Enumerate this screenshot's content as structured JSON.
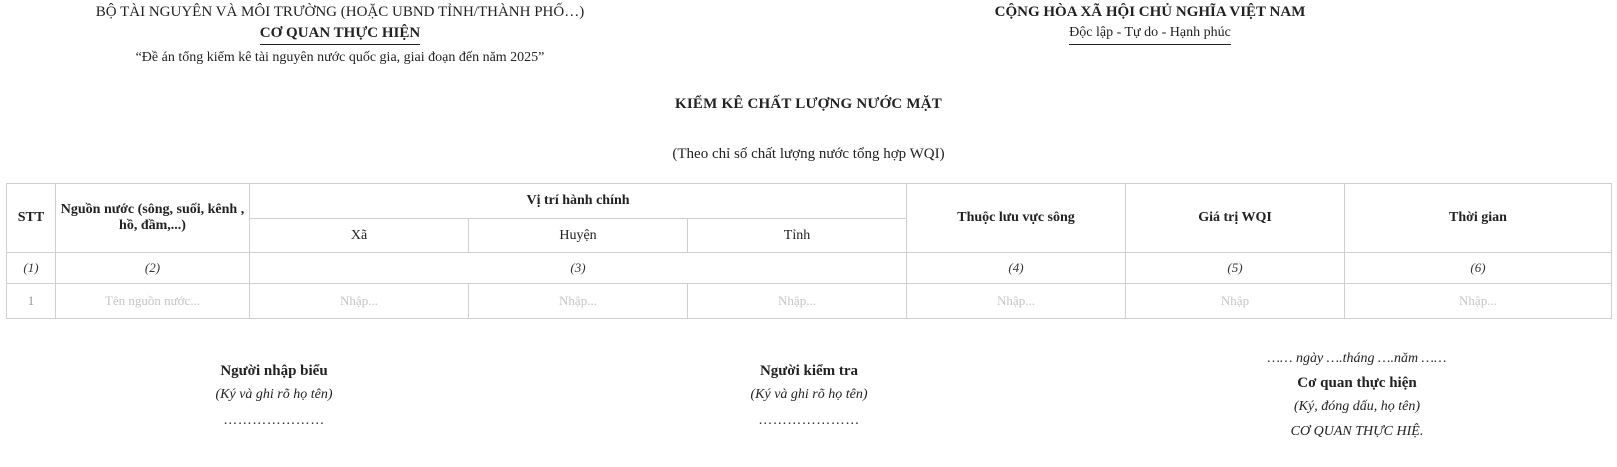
{
  "header": {
    "ministry": "BỘ TÀI NGUYÊN VÀ MÔI TRƯỜNG (HOẶC UBND TỈNH/THÀNH PHỐ…)",
    "agency": "CƠ QUAN THỰC HIỆN",
    "project": "“Đề án tổng kiểm kê tài nguyên nước quốc gia, giai đoạn đến năm 2025”",
    "nation": "CỘNG HÒA XÃ HỘI CHỦ NGHĨA VIỆT NAM",
    "motto": "Độc lập - Tự do - Hạnh phúc"
  },
  "title": "KIỂM KÊ CHẤT LƯỢNG NƯỚC MẶT",
  "subtitle": "(Theo chỉ số chất lượng nước tổng hợp WQI)",
  "table": {
    "headers": {
      "stt": "STT",
      "source": "Nguồn nước (sông, suối, kênh , hồ, đầm,...)",
      "admin_location": "Vị trí hành chính",
      "commune": "Xã",
      "district": "Huyện",
      "province": "Tỉnh",
      "basin": "Thuộc lưu vực sông",
      "wqi": "Giá trị WQI",
      "time": "Thời gian"
    },
    "column_numbers": [
      "(1)",
      "(2)",
      "(3)",
      "(4)",
      "(5)",
      "(6)"
    ],
    "rows": [
      {
        "stt": "1",
        "source": "Tên nguồn nước...",
        "commune": "Nhập...",
        "district": "Nhập...",
        "province": "Nhập...",
        "basin": "Nhập...",
        "wqi": "Nhập",
        "time": "Nhập..."
      }
    ]
  },
  "signatures": {
    "preparer": {
      "role": "Người nhập biểu",
      "hint": "(Ký và ghi rõ họ tên)",
      "dots": "…………………"
    },
    "checker": {
      "role": "Người kiểm tra",
      "hint": "(Ký và ghi rõ họ tên)",
      "dots": "…………………"
    },
    "agency": {
      "date": "…… ngày ….tháng ….năm ……",
      "role": "Cơ quan thực hiện",
      "hint": "(Ký, đóng dấu, họ tên)",
      "name": "CƠ QUAN THỰC HIỆ."
    }
  }
}
